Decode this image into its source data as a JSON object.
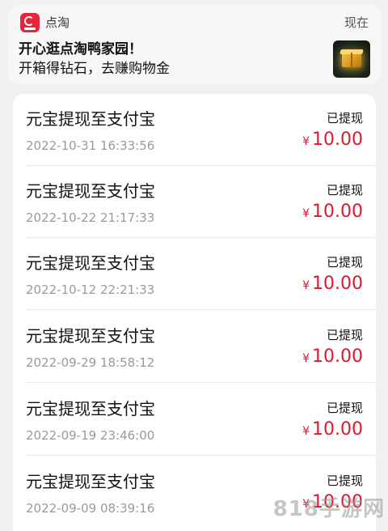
{
  "notification": {
    "app_name": "点淘",
    "time": "现在",
    "title": "开心逛点淘鸭家园！",
    "body": "开箱得钻石，去赚购物金"
  },
  "transactions": [
    {
      "title": "元宝提现至支付宝",
      "date": "2022-10-31 16:33:56",
      "status": "已提现",
      "currency": "¥",
      "amount": "10.00"
    },
    {
      "title": "元宝提现至支付宝",
      "date": "2022-10-22 21:17:33",
      "status": "已提现",
      "currency": "¥",
      "amount": "10.00"
    },
    {
      "title": "元宝提现至支付宝",
      "date": "2022-10-12 22:21:33",
      "status": "已提现",
      "currency": "¥",
      "amount": "10.00"
    },
    {
      "title": "元宝提现至支付宝",
      "date": "2022-09-29 18:58:12",
      "status": "已提现",
      "currency": "¥",
      "amount": "10.00"
    },
    {
      "title": "元宝提现至支付宝",
      "date": "2022-09-19 23:46:00",
      "status": "已提现",
      "currency": "¥",
      "amount": "10.00"
    },
    {
      "title": "元宝提现至支付宝",
      "date": "2022-09-09 08:39:16",
      "status": "已提现",
      "currency": "¥",
      "amount": "10.00"
    }
  ],
  "watermark": "818手游网",
  "colors": {
    "amount": "#e1182c",
    "app_icon": "#e8233a"
  }
}
